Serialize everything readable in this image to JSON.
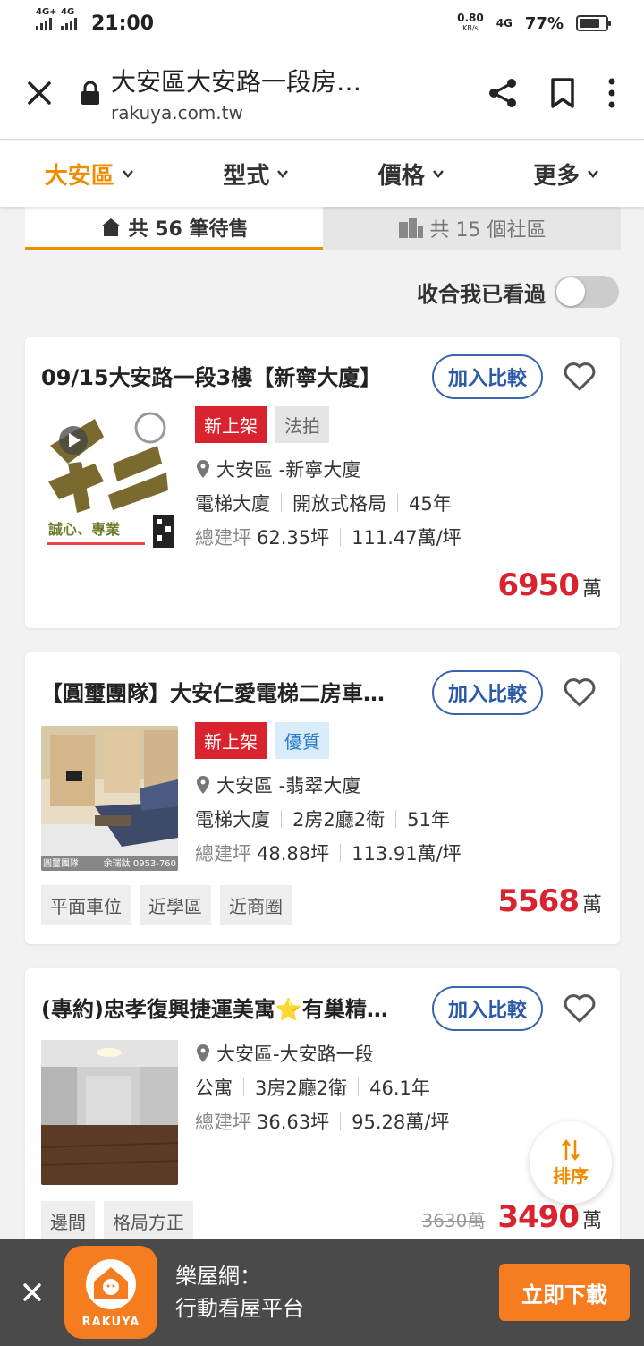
{
  "status_bar": {
    "signal1_label": "4G+",
    "signal2_label": "4G",
    "time": "21:00",
    "speed_value": "0.80",
    "speed_unit": "KB/s",
    "network": "4G",
    "battery": "77%",
    "battery_level": 0.77
  },
  "browser": {
    "page_title": "大安區大安路一段房…",
    "domain": "rakuya.com.tw"
  },
  "filters": [
    {
      "label": "大安區",
      "active": true
    },
    {
      "label": "型式",
      "active": false
    },
    {
      "label": "價格",
      "active": false
    },
    {
      "label": "更多",
      "active": false
    }
  ],
  "tabs": {
    "for_sale": "共 56 筆待售",
    "communities": "共 15 個社區"
  },
  "toggle": {
    "label": "收合我已看過"
  },
  "listings": [
    {
      "title": "09/15大安路一段3樓【新寧大廈】",
      "compare_label": "加入比較",
      "badges": [
        {
          "text": "新上架",
          "style": "red"
        },
        {
          "text": "法拍",
          "style": "grey"
        }
      ],
      "location": "大安區 -新寧大廈",
      "type": "電梯大廈",
      "layout": "開放式格局",
      "age": "45年",
      "area_label": "總建坪",
      "area": "62.35坪",
      "unit_price": "111.47萬/坪",
      "tags": [],
      "old_price": "",
      "price": "6950",
      "price_unit": "萬",
      "thumb_text": [
        "誠心、專業"
      ]
    },
    {
      "title": "【圓璽團隊】大安仁愛電梯二房車…",
      "compare_label": "加入比較",
      "badges": [
        {
          "text": "新上架",
          "style": "red"
        },
        {
          "text": "優質",
          "style": "blue"
        }
      ],
      "location": "大安區 -翡翠大廈",
      "type": "電梯大廈",
      "layout": "2房2廳2衛",
      "age": "51年",
      "area_label": "總建坪",
      "area": "48.88坪",
      "unit_price": "113.91萬/坪",
      "tags": [
        "平面車位",
        "近學區",
        "近商圈"
      ],
      "old_price": "",
      "price": "5568",
      "price_unit": "萬",
      "thumb_text": [
        "圓璽團隊",
        "余瑞鈦 0953-760"
      ]
    },
    {
      "title": "(專約)忠孝復興捷運美寓⭐有巢精…",
      "compare_label": "加入比較",
      "badges": [],
      "location": "大安區-大安路一段",
      "type": "公寓",
      "layout": "3房2廳2衛",
      "age": "46.1年",
      "area_label": "總建坪",
      "area": "36.63坪",
      "unit_price": "95.28萬/坪",
      "tags": [
        "邊間",
        "格局方正"
      ],
      "old_price": "3630萬",
      "price": "3490",
      "price_unit": "萬"
    }
  ],
  "sort_fab": {
    "label": "排序"
  },
  "app_banner": {
    "brand": "RAKUYA",
    "line1": "樂屋網：",
    "line2": "行動看屋平台",
    "download_label": "立即下載"
  },
  "colors": {
    "accent_orange": "#f08c00",
    "price_red": "#d9232e",
    "compare_blue": "#2a5aa8",
    "banner_bg": "#4a4a4a"
  }
}
